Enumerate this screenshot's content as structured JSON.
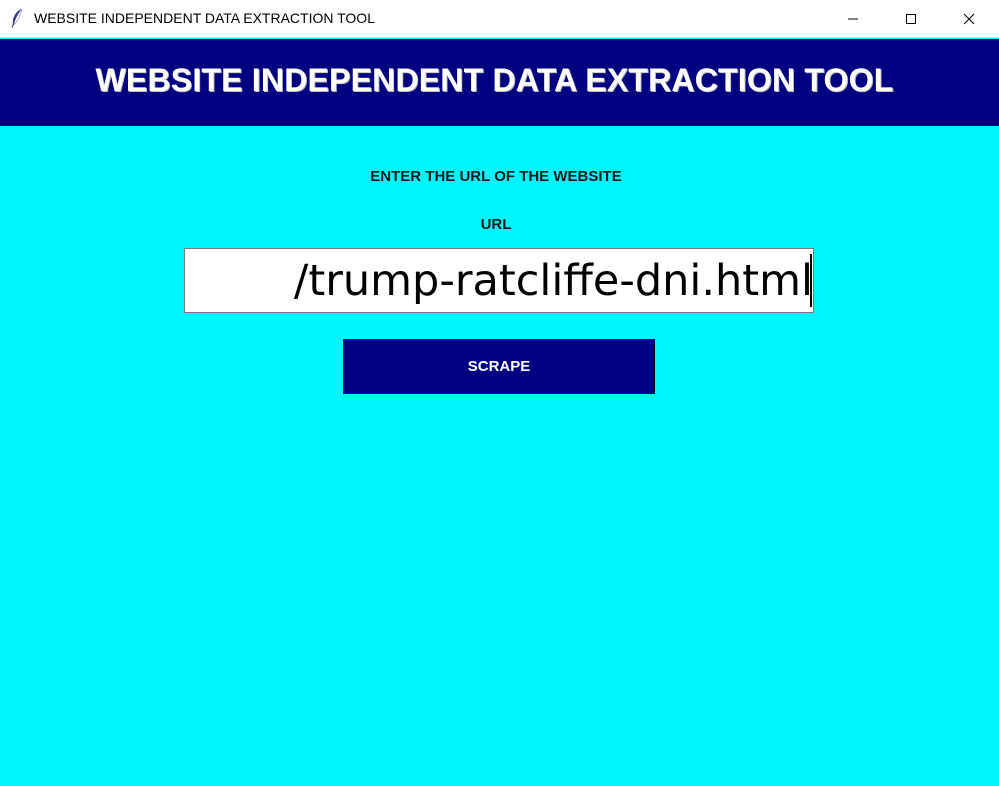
{
  "window": {
    "title": "WEBSITE INDEPENDENT DATA EXTRACTION TOOL",
    "app_icon": "feather-icon",
    "controls": {
      "minimize_icon": "minimize-icon",
      "maximize_icon": "maximize-icon",
      "close_icon": "close-icon"
    }
  },
  "header": {
    "title": "WEBSITE INDEPENDENT DATA EXTRACTION TOOL"
  },
  "form": {
    "instruction": "ENTER THE URL OF THE WEBSITE",
    "url_label": "URL",
    "url_value": "/trump-ratcliffe-dni.html",
    "scrape_label": "SCRAPE"
  },
  "colors": {
    "background": "#00f5ff",
    "header_bg": "#000080",
    "button_bg": "#000080",
    "header_text": "#ffffff"
  }
}
